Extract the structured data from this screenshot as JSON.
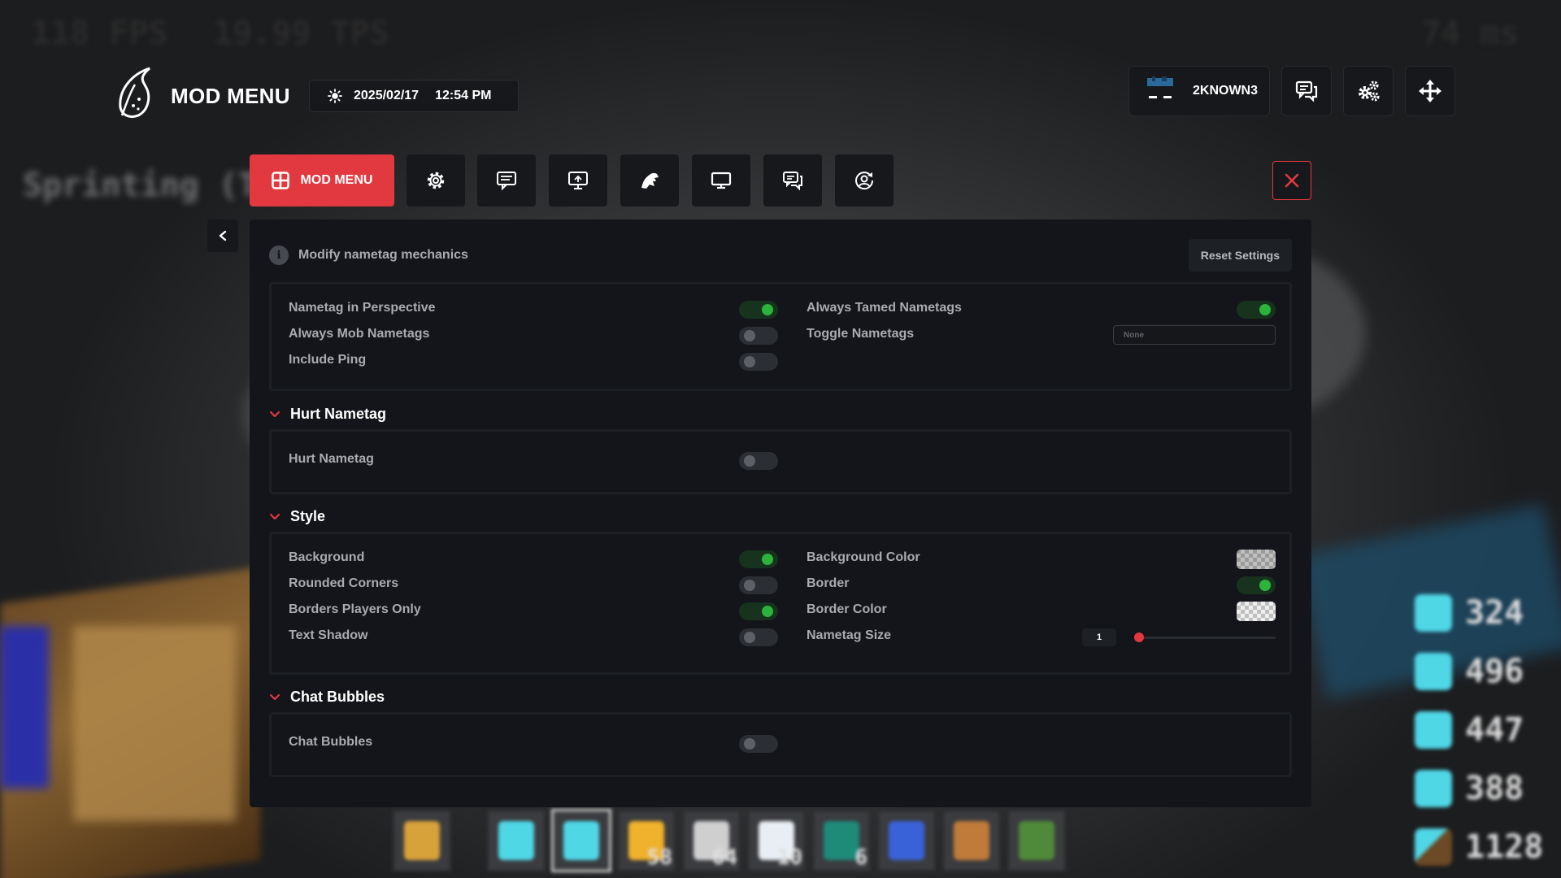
{
  "hud": {
    "fps": "118 FPS",
    "tps": "19.99 TPS",
    "ping": "74 ms",
    "sprint": "Sprinting (Tog"
  },
  "armor": [
    {
      "icon": "helmet-icon",
      "value": "324"
    },
    {
      "icon": "chestplate-icon",
      "value": "496"
    },
    {
      "icon": "leggings-icon",
      "value": "447"
    },
    {
      "icon": "boots-icon",
      "value": "388"
    },
    {
      "icon": "pickaxe-icon",
      "value": "1128"
    }
  ],
  "hotbar": {
    "items": [
      {
        "icon": "totem-icon",
        "color": "#d7a23a"
      },
      {
        "icon": "diamond-sword-icon",
        "color": "#4fd7e6"
      },
      {
        "icon": "diamond-pickaxe-icon",
        "color": "#4fd7e6",
        "selected": true
      },
      {
        "icon": "blaze-rod-icon",
        "color": "#f0b12c",
        "count": "58"
      },
      {
        "icon": "cobweb-icon",
        "color": "#cfcfcf",
        "count": "64"
      },
      {
        "icon": "snowball-icon",
        "color": "#e8eef3",
        "count": "10"
      },
      {
        "icon": "ender-pearl-icon",
        "color": "#1e8a78",
        "count": "6"
      },
      {
        "icon": "water-bucket-icon",
        "color": "#3a62d8"
      },
      {
        "icon": "flint-steel-icon",
        "color": "#c07a3a"
      },
      {
        "icon": "grass-block-icon",
        "color": "#4e8a3a"
      }
    ]
  },
  "header": {
    "brand": "MOD MENU",
    "date": "2025/02/17",
    "time": "12:54 PM",
    "username": "2KNOWN3"
  },
  "tabs": {
    "main_label": "MOD MENU",
    "icons": [
      "gear-icon",
      "message-icon",
      "monitor-icon",
      "cosmetics-icon",
      "display-icon",
      "chat-icon",
      "profile-icon"
    ]
  },
  "colors": {
    "accent": "#e2383f",
    "toggle_on": "#2bb33c",
    "panel_bg": "#13151a"
  },
  "panel": {
    "description": "Modify nametag mechanics",
    "reset_label": "Reset Settings",
    "general": {
      "left": [
        {
          "label": "Nametag in Perspective",
          "on": true
        },
        {
          "label": "Always Mob Nametags",
          "on": false
        },
        {
          "label": "Include Ping",
          "on": false
        }
      ],
      "right_toggle": {
        "label": "Always Tamed Nametags",
        "on": true
      },
      "keybind": {
        "label": "Toggle Nametags",
        "value": "None"
      }
    },
    "hurt": {
      "title": "Hurt Nametag",
      "options": [
        {
          "label": "Hurt Nametag",
          "on": false
        }
      ]
    },
    "style": {
      "title": "Style",
      "left": [
        {
          "label": "Background",
          "on": true
        },
        {
          "label": "Rounded Corners",
          "on": false
        },
        {
          "label": "Borders Players Only",
          "on": true
        },
        {
          "label": "Text Shadow",
          "on": false
        }
      ],
      "background_color": {
        "label": "Background Color"
      },
      "border": {
        "label": "Border",
        "on": true
      },
      "border_color": {
        "label": "Border Color"
      },
      "size": {
        "label": "Nametag Size",
        "value": "1",
        "fraction": 0.0
      }
    },
    "chat": {
      "title": "Chat Bubbles",
      "options": [
        {
          "label": "Chat Bubbles",
          "on": false
        }
      ]
    }
  }
}
